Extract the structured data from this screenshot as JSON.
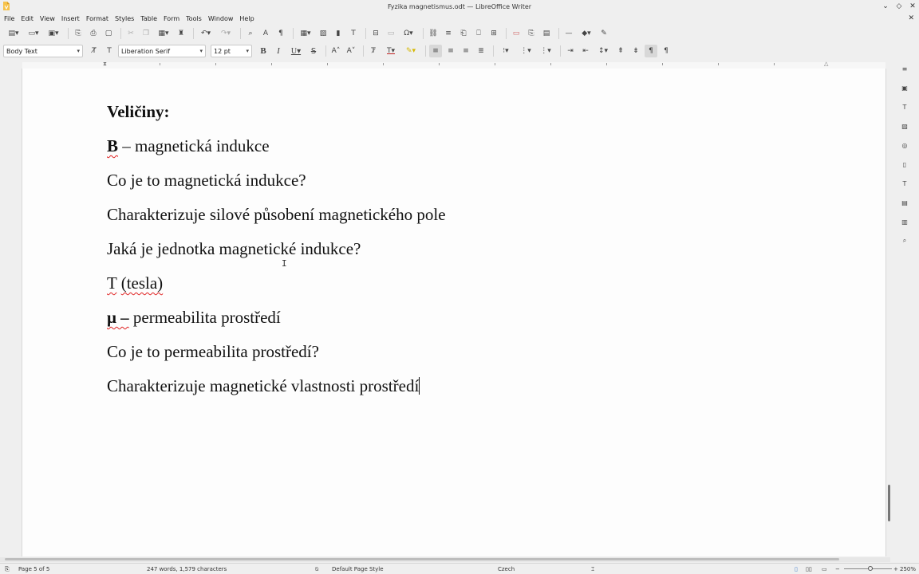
{
  "window": {
    "title": "Fyzika magnetismus.odt — LibreOffice Writer"
  },
  "menu": {
    "items": [
      "File",
      "Edit",
      "View",
      "Insert",
      "Format",
      "Styles",
      "Table",
      "Form",
      "Tools",
      "Window",
      "Help"
    ]
  },
  "formatting": {
    "paragraph_style": "Body Text",
    "font_name": "Liberation Serif",
    "font_size": "12 pt"
  },
  "document": {
    "heading": "Veličiny:",
    "p1_bold": "B",
    "p1_rest": " – magnetická indukce",
    "p2": "Co je to magnetická indukce?",
    "p3": "Charakterizuje silové působení magnetického pole",
    "p4": "Jaká je jednotka magnetické indukce?",
    "p5_t": "T",
    "p5_space": " ",
    "p5_tesla": "(tesla)",
    "p6_bold": "μ –",
    "p6_rest": " permeabilita prostředí",
    "p7": "Co je to permeabilita prostředí?",
    "p8": "Charakterizuje magnetické vlastnosti prostředí"
  },
  "status": {
    "page": "Page 5 of 5",
    "words": "247 words, 1,579 characters",
    "page_style": "Default Page Style",
    "language": "Czech",
    "zoom": "250%"
  },
  "colors": {
    "accent": "#e8a33a",
    "spellcheck": "#e02020"
  }
}
